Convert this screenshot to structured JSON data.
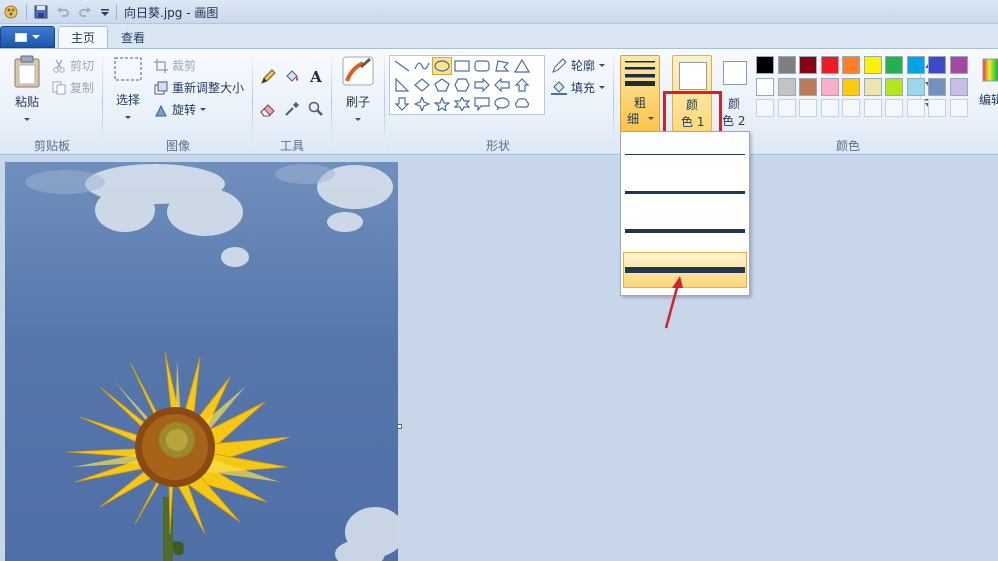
{
  "window": {
    "title": "向日葵.jpg - 画图"
  },
  "tabs": {
    "file": "",
    "home": "主页",
    "view": "查看"
  },
  "clipboard": {
    "paste": "粘贴",
    "cut": "剪切",
    "copy": "复制",
    "label": "剪贴板"
  },
  "image": {
    "select": "选择",
    "crop": "裁剪",
    "resize": "重新调整大小",
    "rotate": "旋转",
    "label": "图像"
  },
  "tools": {
    "label": "工具",
    "text_tool": "A"
  },
  "brushes": {
    "label": "刷子"
  },
  "shapes": {
    "outline": "轮廓",
    "fill": "填充",
    "label": "形状"
  },
  "size": {
    "label_line1": "粗",
    "label_line2": "细"
  },
  "color1": {
    "line1": "颜",
    "line2": "色 1"
  },
  "color2": {
    "line1": "颜",
    "line2": "色 2"
  },
  "colors": {
    "label": "颜色",
    "edit": "编辑",
    "row1": [
      "#000000",
      "#7f7f7f",
      "#880015",
      "#ed1c24",
      "#ff7f27",
      "#fff200",
      "#22b14c",
      "#00a2e8",
      "#3f48cc",
      "#a349a4"
    ],
    "row2": [
      "#ffffff",
      "#c3c3c3",
      "#b97a57",
      "#ffaec9",
      "#ffc90e",
      "#efe4b0",
      "#b5e61d",
      "#99d9ea",
      "#7092be",
      "#c8bfe7"
    ]
  },
  "size_menu": {
    "levels": [
      "1px",
      "3px",
      "5px",
      "8px"
    ],
    "selected_index": 3
  },
  "accent": {
    "highlight": "#fbc34a",
    "annotation_red": "#d6202a"
  }
}
